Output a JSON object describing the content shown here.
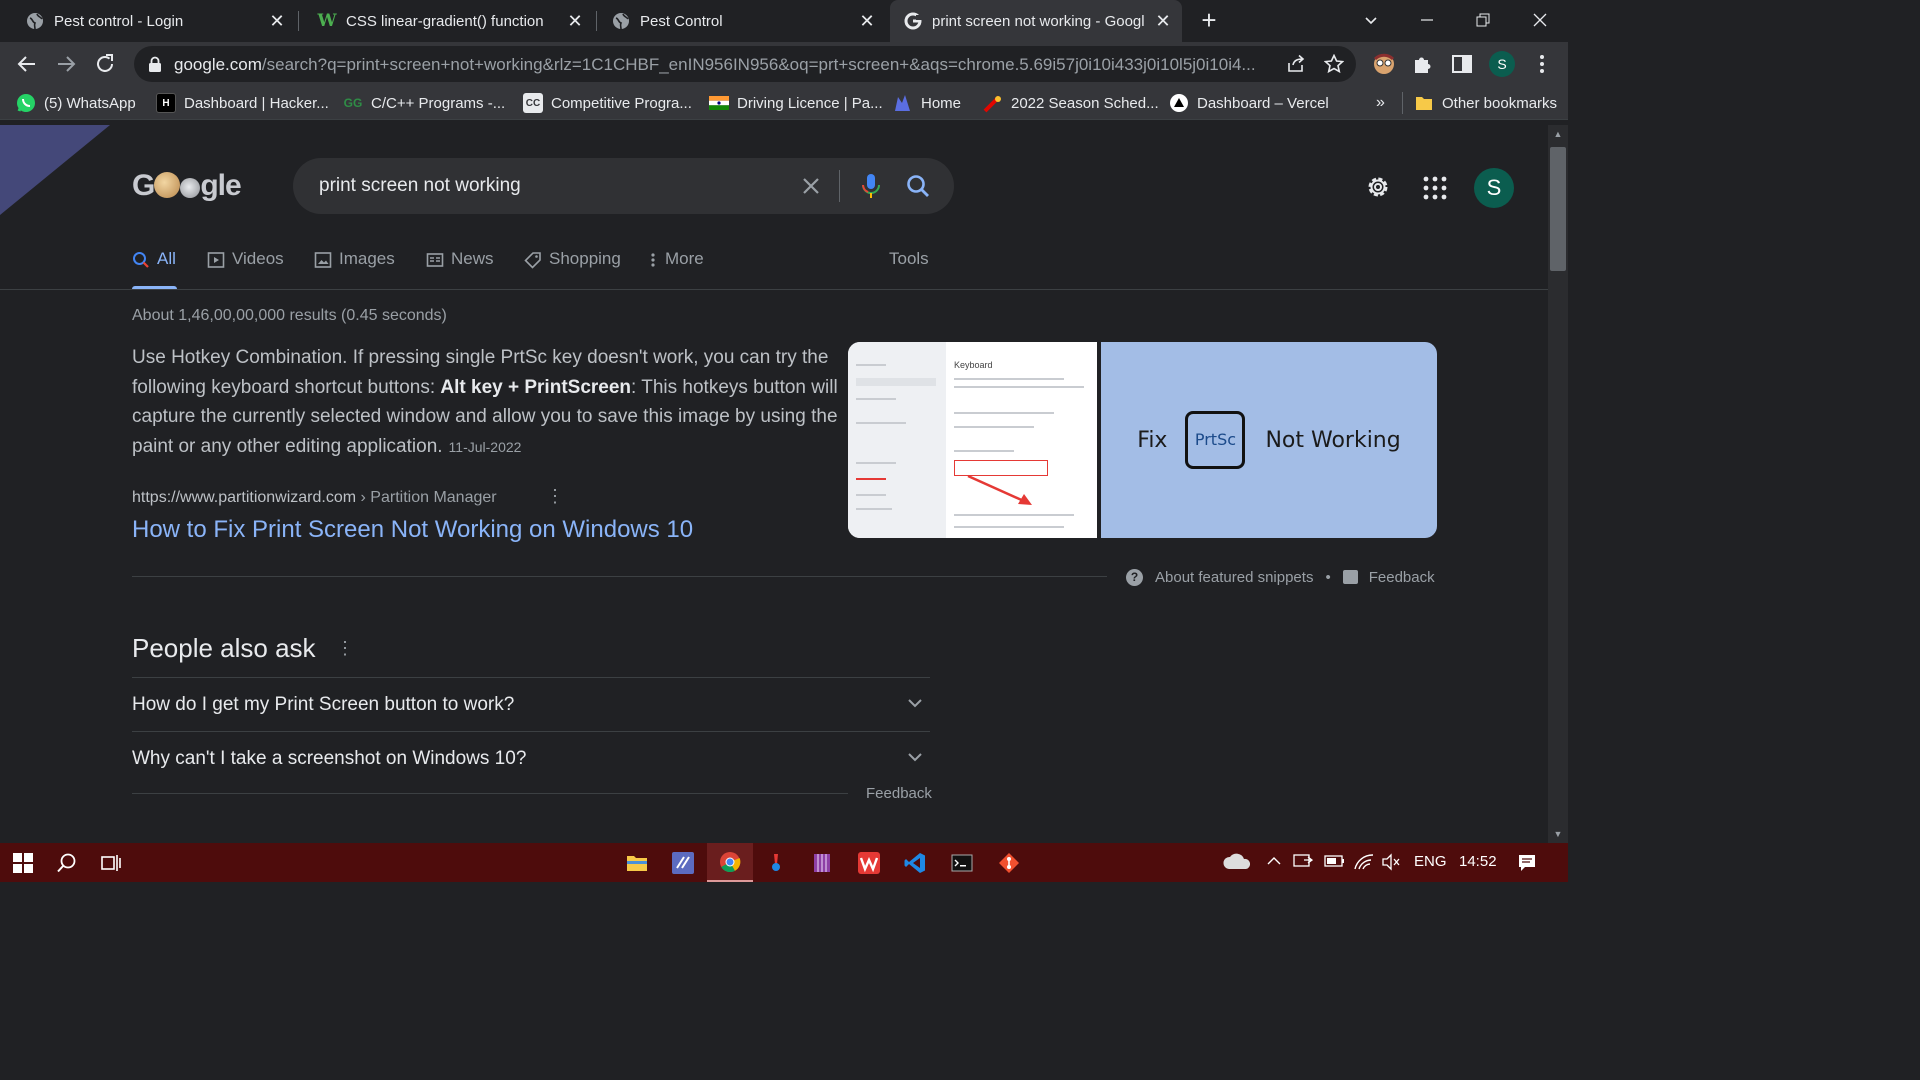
{
  "browser": {
    "tabs": [
      {
        "title": "Pest control - Login",
        "active": false
      },
      {
        "title": "CSS linear-gradient() function",
        "active": false
      },
      {
        "title": "Pest Control",
        "active": false
      },
      {
        "title": "print screen not working - Googl",
        "active": true
      }
    ],
    "url": {
      "host": "google.com",
      "path": "/search?q=print+screen+not+working&rlz=1C1CHBF_enIN956IN956&oq=prt+screen+&aqs=chrome.5.69i57j0i10i433j0i10l5j0i10i4..."
    },
    "profile_initial": "S",
    "bookmarks": [
      {
        "label": "(5) WhatsApp",
        "icon": "whatsapp-icon",
        "color": "#25d366"
      },
      {
        "label": "Dashboard | Hacker...",
        "icon": "hackerrank-icon",
        "color": "#000000"
      },
      {
        "label": "C/C++ Programs -...",
        "icon": "gfg-icon",
        "color": "#2f8d46"
      },
      {
        "label": "Competitive Progra...",
        "icon": "cc-icon",
        "color": "#e8eaed"
      },
      {
        "label": "Driving Licence | Pa...",
        "icon": "india-flag-icon",
        "color": "#ff9933"
      },
      {
        "label": "Home",
        "icon": "home-site-icon",
        "color": "#5b6ee1"
      },
      {
        "label": "2022 Season Sched...",
        "icon": "f1-icon",
        "color": "#e10600"
      },
      {
        "label": "Dashboard – Vercel",
        "icon": "vercel-icon",
        "color": "#ffffff"
      }
    ],
    "bookmarks_overflow": "»",
    "other_bookmarks": "Other bookmarks"
  },
  "search": {
    "logo_text_before": "G",
    "logo_text_after": "gle",
    "query": "print screen not working",
    "tabs": [
      {
        "label": "All",
        "icon": "search-icon",
        "active": true
      },
      {
        "label": "Videos",
        "icon": "video-icon",
        "active": false
      },
      {
        "label": "Images",
        "icon": "image-icon",
        "active": false
      },
      {
        "label": "News",
        "icon": "news-icon",
        "active": false
      },
      {
        "label": "Shopping",
        "icon": "tag-icon",
        "active": false
      },
      {
        "label": "More",
        "icon": "more-vert-icon",
        "active": false
      }
    ],
    "tools_label": "Tools",
    "stats": "About 1,46,00,00,000 results (0.45 seconds)",
    "account_initial": "S"
  },
  "snippet": {
    "text_1": "Use Hotkey Combination. If pressing single PrtSc key doesn't work, you can try the following keyboard shortcut buttons: ",
    "bold": "Alt key + PrintScreen",
    "text_2": ": This hotkeys button will capture the currently selected window and allow you to save this image by using the paint or any other editing application.",
    "date": "11-Jul-2022",
    "image1_title": "Keyboard",
    "image2_fix": "Fix",
    "image2_key": "PrtSc",
    "image2_rest": "Not Working",
    "cite_url": "https://www.partitionwizard.com",
    "cite_crumb": " › Partition Manager",
    "link": "How to Fix Print Screen Not Working on Windows 10",
    "about_label": "About featured snippets",
    "dot": "•",
    "feedback_label": "Feedback"
  },
  "people_also_ask": {
    "title": "People also ask",
    "questions": [
      "How do I get my Print Screen button to work?",
      "Why can't I take a screenshot on Windows 10?"
    ],
    "feedback_label": "Feedback"
  },
  "taskbar": {
    "language": "ENG",
    "time": "14:52",
    "apps": [
      "file-explorer-icon",
      "visual-studio-icon",
      "chrome-icon",
      "paint-icon",
      "winrar-icon",
      "wps-icon",
      "vscode-icon",
      "terminal-icon",
      "git-icon"
    ]
  },
  "colors": {
    "accent_blue": "#8ab4f8",
    "page_bg": "#202124",
    "taskbar_bg": "#4e0c0c",
    "avatar_green": "#0b5d4f"
  }
}
